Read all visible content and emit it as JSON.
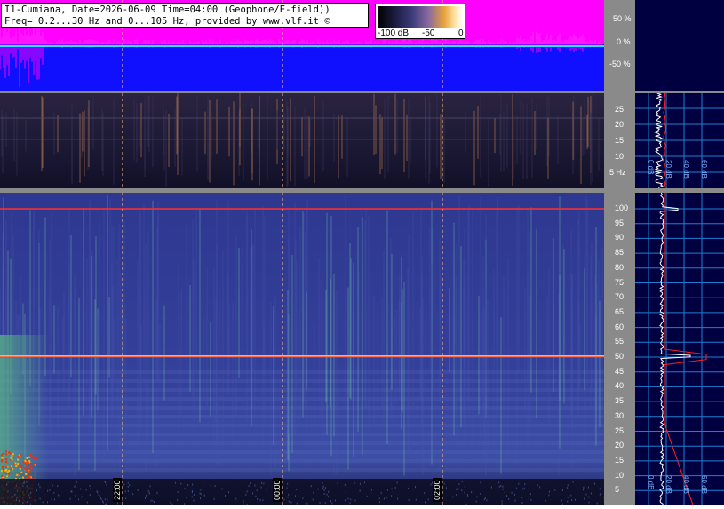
{
  "header": {
    "line1": "I1-Cumiana, Date=2026-06-09 Time=04:00 (Geophone/E-field))",
    "line2": "Freq= 0.2...30 Hz and 0...105 Hz, provided by www.vlf.it ©"
  },
  "legend": {
    "labels": [
      "-100 dB",
      "-50",
      "0"
    ]
  },
  "amplitude_axis": {
    "ticks": [
      "50 %",
      "0 %",
      "-50 %"
    ]
  },
  "top_spectrum_axis": {
    "ticks": [
      "25",
      "20",
      "15",
      "10",
      "5 Hz"
    ],
    "db_labels": [
      "0 dB",
      "20 dB",
      "40 dB",
      "60 dB"
    ]
  },
  "main_spectrum_axis": {
    "ticks": [
      "100",
      "95",
      "90",
      "85",
      "80",
      "75",
      "70",
      "65",
      "60",
      "55",
      "50",
      "45",
      "40",
      "35",
      "30",
      "25",
      "20",
      "15",
      "10",
      "5"
    ],
    "db_labels": [
      "0 dB",
      "20 dB",
      "40 dB",
      "60 dB"
    ]
  },
  "time_labels": [
    "22:00",
    "00:00",
    "02:00"
  ],
  "colors": {
    "amplitude_bg": "#1010ff",
    "amplitude_fill": "#ff00ff",
    "gray_frame": "#8a8a8a",
    "side_panel": "#000040",
    "spectrum_trace": "#ffffff",
    "average_trace": "#ff2020",
    "grid": "#1e7fd0"
  }
}
